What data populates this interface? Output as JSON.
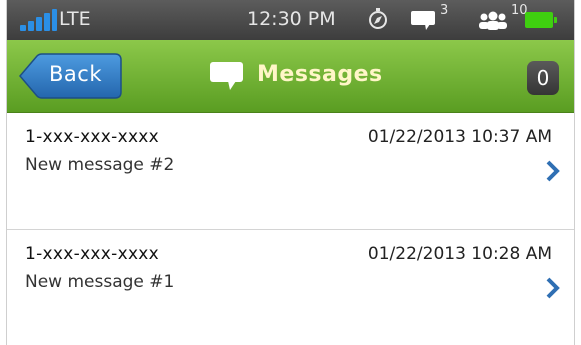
{
  "statusbar": {
    "carrier": "LTE",
    "time": "12:30 PM",
    "message_count": "3",
    "people_count": "10"
  },
  "navbar": {
    "back_label": "Back",
    "title": "Messages",
    "count": "0"
  },
  "messages": [
    {
      "sender": "1-xxx-xxx-xxxx",
      "timestamp": "01/22/2013 10:37 AM",
      "preview": "New message #2"
    },
    {
      "sender": "1-xxx-xxx-xxxx",
      "timestamp": "01/22/2013 10:28 AM",
      "preview": "New message #1"
    }
  ],
  "colors": {
    "navbar": "#7ab83a",
    "back_button": "#2f7fc8",
    "title": "#fff6c8",
    "chevron": "#2f6fb3",
    "signal": "#2b8fe6",
    "battery": "#3fcf10"
  }
}
